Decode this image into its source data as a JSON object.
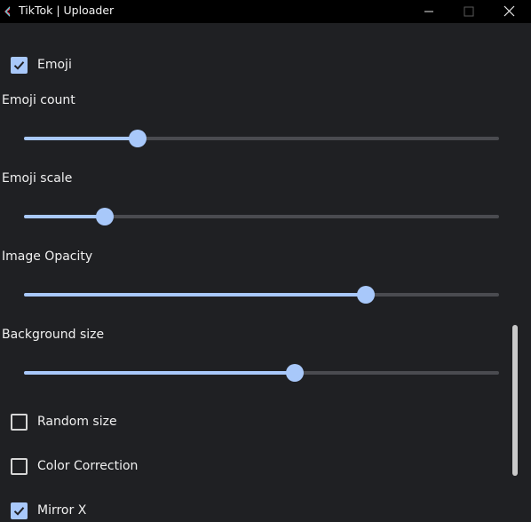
{
  "window": {
    "title": "TikTok | Uploader",
    "icon": "tiktok-app-icon",
    "controls": [
      "minimize-icon",
      "maximize-icon",
      "close-icon"
    ]
  },
  "settings": {
    "emoji": {
      "label": "Emoji",
      "checked": true
    },
    "emoji_count": {
      "label": "Emoji count",
      "value": 0.24
    },
    "emoji_scale": {
      "label": "Emoji scale",
      "value": 0.17
    },
    "image_opacity": {
      "label": "Image Opacity",
      "value": 0.72
    },
    "background_size": {
      "label": "Background size",
      "value": 0.57
    },
    "random_size": {
      "label": "Random size",
      "checked": false
    },
    "color_correction": {
      "label": "Color Correction",
      "checked": false
    },
    "mirror_x": {
      "label": "Mirror X",
      "checked": true
    }
  },
  "colors": {
    "accent": "#a8c8fa",
    "background": "#1f2023",
    "titlebar": "#000000",
    "track": "#4a4b50"
  }
}
